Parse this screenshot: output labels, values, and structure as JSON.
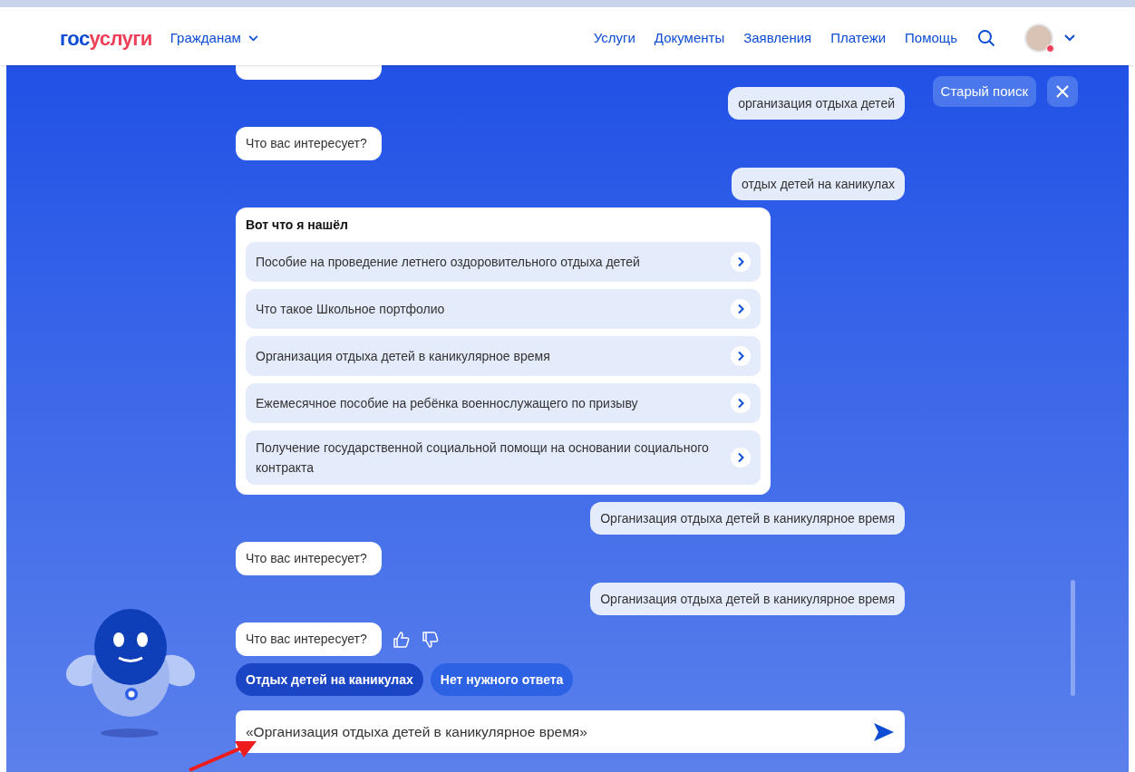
{
  "header": {
    "logo": {
      "part1": "гос",
      "part2": "услуги"
    },
    "audience": "Гражданам",
    "nav": [
      "Услуги",
      "Документы",
      "Заявления",
      "Платежи",
      "Помощь"
    ]
  },
  "top_actions": {
    "old_search": "Старый поиск"
  },
  "chat": [
    {
      "kind": "bot"
    },
    {
      "kind": "user",
      "text": "организация отдыха детей"
    },
    {
      "kind": "bot",
      "text": "Что вас интересует?"
    },
    {
      "kind": "user",
      "text": "отдых детей на каникулах"
    },
    {
      "kind": "results",
      "title": "Вот что я нашёл",
      "items": [
        "Пособие на проведение летнего оздоровительного отдыха детей",
        "Что такое Школьное портфолио",
        "Организация отдыха детей в каникулярное время",
        "Ежемесячное пособие на ребёнка военнослужащего по призыву",
        "Получение государственной социальной помощи на основании социального контракта"
      ]
    },
    {
      "kind": "user",
      "text": "Организация отдыха детей в каникулярное время"
    },
    {
      "kind": "bot",
      "text": "Что вас интересует?"
    },
    {
      "kind": "user",
      "text": "Организация отдыха детей в каникулярное время"
    },
    {
      "kind": "bot",
      "text": "Что вас интересует?",
      "feedback": true
    }
  ],
  "quick_replies": [
    {
      "label": "Отдых детей на каникулах",
      "selected": true
    },
    {
      "label": "Нет нужного ответа",
      "selected": false
    }
  ],
  "input": {
    "value": "«Организация отдыха детей в каникулярное время»"
  }
}
